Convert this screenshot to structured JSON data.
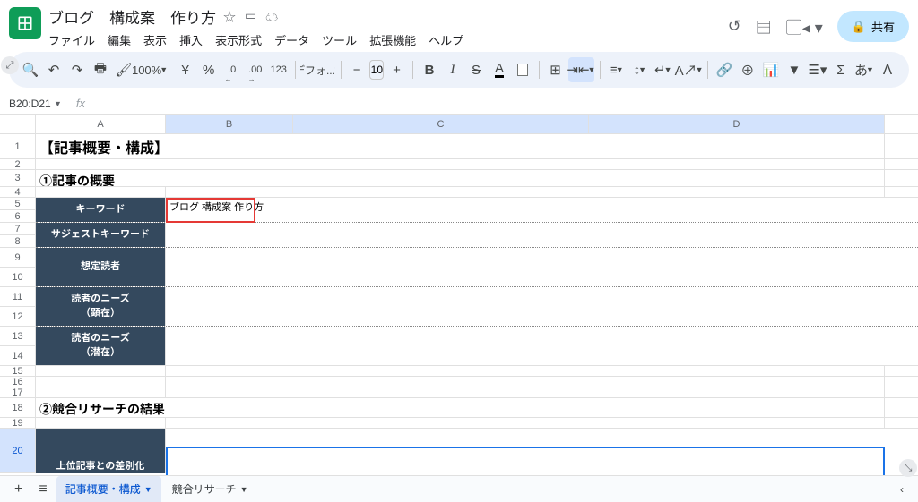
{
  "doc": {
    "title": "ブログ　構成案　作り方"
  },
  "menu": [
    "ファイル",
    "編集",
    "表示",
    "挿入",
    "表示形式",
    "データ",
    "ツール",
    "拡張機能",
    "ヘルプ"
  ],
  "header": {
    "share": "共有"
  },
  "toolbar": {
    "zoom": "100%",
    "currency": "¥",
    "percent": "%",
    "dec_dec": ".0",
    "dec_inc": ".00",
    "numfmt": "123",
    "font": "デフォ...",
    "fontsize": "10",
    "ja": "あ"
  },
  "namebox": "B20:D21",
  "columns": [
    "A",
    "B",
    "C",
    "D"
  ],
  "rows": [
    "1",
    "2",
    "3",
    "4",
    "5",
    "6",
    "7",
    "8",
    "9",
    "10",
    "11",
    "12",
    "13",
    "14",
    "15",
    "16",
    "17",
    "18",
    "19",
    "20"
  ],
  "content": {
    "a1": "【記事概要・構成】",
    "a3": "①記事の概要",
    "labels": {
      "keyword": "キーワード",
      "suggest": "サジェストキーワード",
      "reader": "想定読者",
      "needs1": "読者のニーズ\n（顕在）",
      "needs2": "読者のニーズ\n（潜在）",
      "diff": "上位記事との差別化"
    },
    "b5": "ブログ 構成案 作り方",
    "a18": "②競合リサーチの結果"
  },
  "sheets": {
    "s1": "記事概要・構成",
    "s2": "競合リサーチ"
  }
}
